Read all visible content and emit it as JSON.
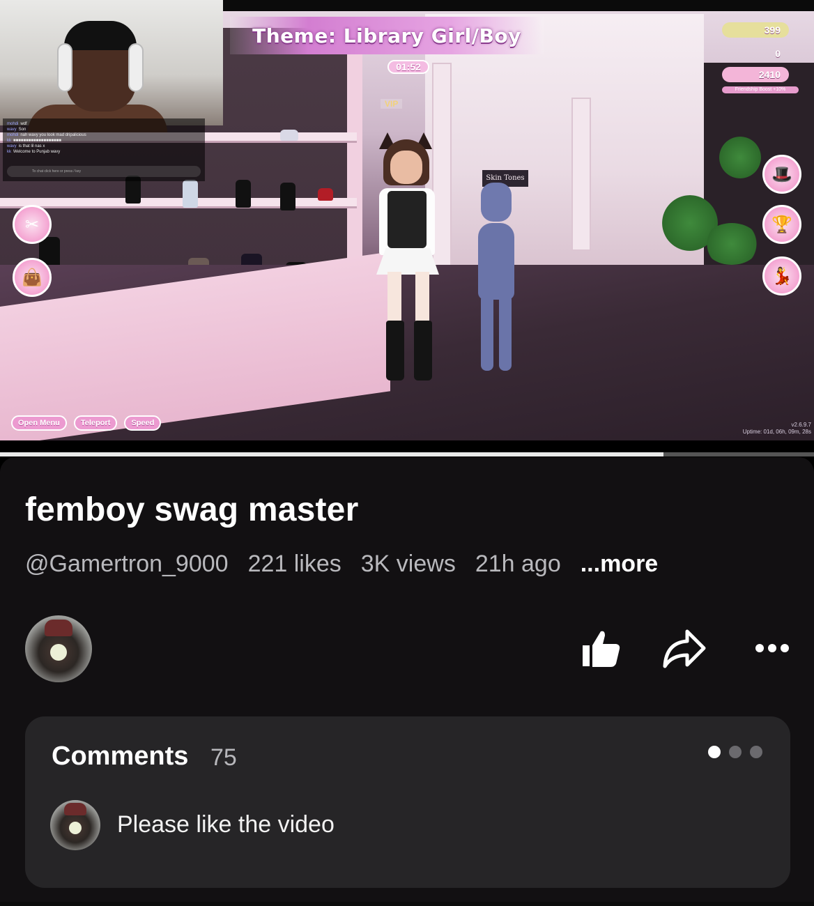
{
  "video": {
    "theme_text": "Theme: Library Girl/Boy",
    "timer": "01:52",
    "vip_label": "VIP",
    "stats": {
      "stars": "399",
      "gems": "0",
      "currency": "2410",
      "friend_boost": "Friendship Boost +10%"
    },
    "skin_tones_label": "Skin Tones",
    "buttons": {
      "open_menu": "Open Menu",
      "teleport": "Teleport",
      "speed": "Speed"
    },
    "version": "v2.6.9.7",
    "uptime": "Uptime: 01d, 06h, 09m, 28s",
    "chat": {
      "lines": [
        {
          "user": "mohdi",
          "text": "wdf"
        },
        {
          "user": "wavy",
          "text": "Son"
        },
        {
          "user": "mohdi",
          "text": "nah wavy you look mad dripalicious"
        },
        {
          "user": "kk",
          "text": "■■■■■■■■■■■■■■■■■■■"
        },
        {
          "user": "wavy",
          "text": "is that lil nas x"
        },
        {
          "user": "kk",
          "text": "Welcome to Punjab wavy"
        }
      ],
      "input_placeholder": "To chat click here or press / key"
    },
    "progress_fraction": 0.815
  },
  "info": {
    "title": "femboy swag master",
    "channel": "@Gamertron_9000",
    "likes": "221 likes",
    "views": "3K views",
    "age": "21h ago",
    "more": "...more"
  },
  "actions": {
    "like_icon": "thumbs-up-icon",
    "share_icon": "share-arrow-icon",
    "more_icon": "more-dots-icon"
  },
  "comments": {
    "header": "Comments",
    "count": "75",
    "first_comment": "Please like the video",
    "pager_active": 0,
    "pager_total": 3
  },
  "colors": {
    "panel_bg": "#121012",
    "card_bg": "#262527",
    "meta_text": "#b9b9bd",
    "theme_pink": "#d37ed1"
  }
}
